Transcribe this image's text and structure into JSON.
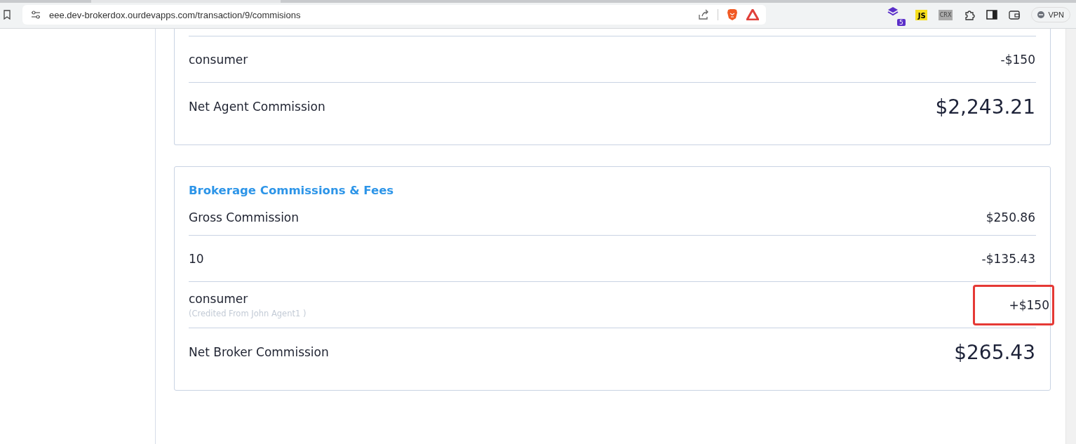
{
  "browser": {
    "url": "eee.dev-brokerdox.ourdevapps.com/transaction/9/commisions",
    "extension_badge": "5",
    "js_label": "JS",
    "crx_label": "CRX",
    "vpn_label": "VPN"
  },
  "cards": [
    {
      "rows": [
        {
          "kind": "line",
          "label": "consumer",
          "amount": "-$150"
        },
        {
          "kind": "total",
          "label": "Net Agent Commission",
          "amount": "$2,243.21"
        }
      ]
    },
    {
      "title": "Brokerage Commissions & Fees",
      "rows": [
        {
          "kind": "line",
          "label": "Gross Commission",
          "amount": "$250.86"
        },
        {
          "kind": "line",
          "label": "10",
          "amount": "-$135.43"
        },
        {
          "kind": "line",
          "label": "consumer",
          "note": "(Credited From John Agent1 )",
          "amount": "+$150",
          "highlighted": true
        },
        {
          "kind": "total",
          "label": "Net Broker Commission",
          "amount": "$265.43"
        }
      ]
    }
  ]
}
